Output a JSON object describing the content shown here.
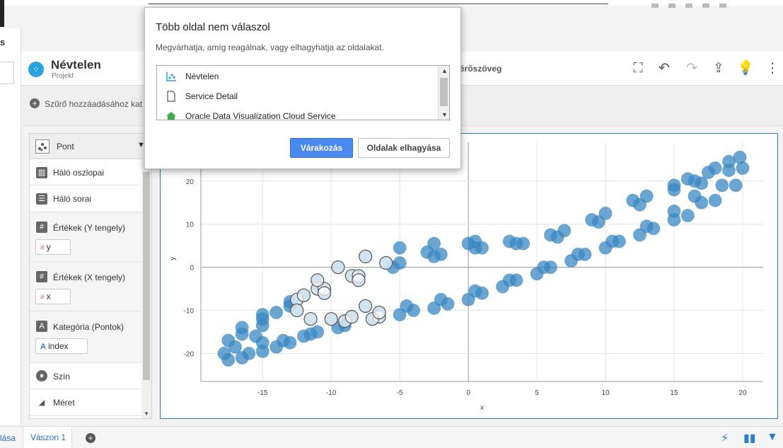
{
  "browser": {
    "cut_left_text": "s"
  },
  "project": {
    "name": "Névtelen",
    "subtitle": "Projekt",
    "title_fragment": "érőszöveg"
  },
  "toolbar_icons": [
    "present-icon",
    "undo-icon",
    "redo-icon",
    "share-icon",
    "insight-icon",
    "more-icon"
  ],
  "filterbar": {
    "placeholder_text": "Szűrő hozzáadásához kat"
  },
  "grammar": {
    "viz_type": "Pont",
    "sections": [
      {
        "label": "Háló oszlopai",
        "icon": "grid-columns-icon"
      },
      {
        "label": "Háló sorai",
        "icon": "grid-rows-icon"
      },
      {
        "label": "Értékek (Y tengely)",
        "icon": "hash-icon",
        "pill": "y",
        "pill_type": "number"
      },
      {
        "label": "Értékek (X tengely)",
        "icon": "hash-icon",
        "pill": "x",
        "pill_type": "number"
      },
      {
        "label": "Kategória (Pontok)",
        "icon": "text-icon",
        "pill": "index",
        "pill_type": "attribute"
      },
      {
        "label": "Szín",
        "icon": "palette-icon"
      },
      {
        "label": "Méret",
        "icon": "size-icon"
      }
    ]
  },
  "chart_data": {
    "type": "scatter",
    "title": "",
    "xlabel": "x",
    "ylabel": "y",
    "xlim": [
      -19.5,
      21.5
    ],
    "ylim": [
      -26.5,
      29
    ],
    "xticks": [
      -15,
      -10,
      -5,
      0,
      5,
      10,
      15,
      20
    ],
    "yticks": [
      -20,
      -10,
      0,
      10,
      20
    ],
    "grid": true,
    "marker_color": "#3a87c1",
    "highlight_color": "#555555",
    "highlight_region": {
      "x": [
        -12.5,
        -6
      ],
      "y": [
        -13,
        5
      ]
    },
    "series": [
      {
        "values_xy": [
          [
            -7.5,
            -9.0
          ],
          [
            -9.0,
            -12.5
          ],
          [
            -11.0,
            -15.0
          ],
          [
            -13.0,
            -17.5
          ],
          [
            -15.0,
            -19.5
          ],
          [
            -16.5,
            -21.0
          ],
          [
            -17.5,
            -21.5
          ],
          [
            -17.8,
            -20.0
          ],
          [
            -17.5,
            -17.0
          ],
          [
            -16.5,
            -14.0
          ],
          [
            -15.0,
            -11.0
          ],
          [
            -13.0,
            -8.0
          ],
          [
            -11.0,
            -5.0
          ],
          [
            -8.5,
            -2.0
          ],
          [
            -6.0,
            1.0
          ],
          [
            -3.0,
            3.5
          ],
          [
            0.0,
            5.5
          ],
          [
            3.0,
            6.0
          ],
          [
            6.0,
            7.5
          ],
          [
            9.0,
            11.0
          ],
          [
            12.0,
            15.5
          ],
          [
            15.0,
            19.0
          ],
          [
            17.5,
            22.0
          ],
          [
            19.0,
            24.5
          ],
          [
            19.8,
            25.5
          ],
          [
            20.0,
            23.0
          ],
          [
            19.5,
            19.0
          ],
          [
            18.0,
            15.5
          ],
          [
            16.0,
            12.0
          ],
          [
            13.5,
            9.0
          ],
          [
            11.0,
            6.0
          ],
          [
            8.5,
            3.0
          ],
          [
            6.0,
            0.0
          ],
          [
            3.5,
            -3.0
          ],
          [
            1.0,
            -6.0
          ],
          [
            -1.5,
            -8.5
          ],
          [
            -4.0,
            -10.0
          ],
          [
            -6.5,
            -11.5
          ],
          [
            -9.0,
            -13.5
          ],
          [
            -11.5,
            -15.5
          ],
          [
            -13.5,
            -17.0
          ],
          [
            -15.0,
            -17.5
          ],
          [
            -15.5,
            -16.0
          ],
          [
            -15.0,
            -13.5
          ],
          [
            -14.0,
            -10.5
          ],
          [
            -12.5,
            -7.5
          ],
          [
            -10.5,
            -5.0
          ],
          [
            -8.0,
            -2.0
          ],
          [
            -5.0,
            1.0
          ],
          [
            -2.0,
            3.0
          ],
          [
            1.0,
            4.5
          ],
          [
            4.0,
            5.5
          ],
          [
            7.0,
            8.5
          ],
          [
            10.0,
            12.5
          ],
          [
            13.0,
            16.5
          ],
          [
            16.0,
            20.5
          ],
          [
            18.0,
            23.0
          ],
          [
            19.0,
            22.5
          ],
          [
            18.5,
            19.0
          ],
          [
            17.0,
            15.0
          ],
          [
            15.0,
            11.0
          ],
          [
            12.5,
            7.5
          ],
          [
            10.0,
            4.5
          ],
          [
            7.5,
            1.5
          ],
          [
            5.0,
            -1.5
          ],
          [
            2.5,
            -4.5
          ],
          [
            0.0,
            -7.5
          ],
          [
            -2.5,
            -9.5
          ],
          [
            -5.0,
            -11.0
          ],
          [
            -7.0,
            -12.0
          ],
          [
            -9.5,
            -14.0
          ],
          [
            -12.0,
            -16.0
          ],
          [
            -14.0,
            -18.5
          ],
          [
            -16.0,
            -20.0
          ],
          [
            -17.0,
            -18.5
          ],
          [
            -16.5,
            -15.5
          ],
          [
            -15.0,
            -12.0
          ],
          [
            -13.0,
            -9.0
          ],
          [
            -10.5,
            -6.0
          ],
          [
            -8.0,
            -3.0
          ],
          [
            -5.5,
            0.0
          ],
          [
            -2.5,
            2.5
          ],
          [
            0.5,
            4.5
          ],
          [
            3.5,
            5.5
          ],
          [
            6.5,
            7.0
          ],
          [
            9.5,
            10.5
          ],
          [
            12.5,
            14.5
          ],
          [
            15.0,
            18.0
          ],
          [
            16.5,
            20.0
          ],
          [
            17.0,
            19.5
          ],
          [
            16.5,
            16.5
          ],
          [
            15.0,
            13.0
          ],
          [
            13.0,
            9.5
          ],
          [
            10.5,
            6.0
          ],
          [
            8.0,
            3.0
          ],
          [
            5.5,
            0.0
          ],
          [
            3.0,
            -3.0
          ],
          [
            0.5,
            -5.5
          ],
          [
            -2.0,
            -7.5
          ],
          [
            -4.5,
            -9.0
          ],
          [
            -6.5,
            -10.5
          ],
          [
            -8.5,
            -11.5
          ],
          [
            -10.0,
            -12.0
          ],
          [
            -11.5,
            -12.0
          ],
          [
            -12.5,
            -10.0
          ],
          [
            -12.0,
            -6.5
          ],
          [
            -11.0,
            -3.0
          ],
          [
            -9.5,
            0.0
          ],
          [
            -7.5,
            2.5
          ],
          [
            -5.0,
            4.5
          ],
          [
            -2.5,
            5.5
          ],
          [
            0.5,
            6.0
          ]
        ]
      }
    ]
  },
  "dialog": {
    "title": "Több oldal nem válaszol",
    "message": "Megvárhatja, amíg reagálnak, vagy elhagyhatja az oldalakat.",
    "items": [
      {
        "label": "Névtelen",
        "icon": "dv-chart-icon"
      },
      {
        "label": "Service Detail",
        "icon": "document-icon"
      },
      {
        "label": "Oracle Data Visualization Cloud Service",
        "icon": "home-icon"
      }
    ],
    "wait_button": "Várakozás",
    "leave_button": "Oldalak elhagyása"
  },
  "bottombar": {
    "frag_text": "lása",
    "tab_label": "Vászon 1",
    "icons": [
      "lightning-icon",
      "chart-settings-icon",
      "filter-icon"
    ]
  }
}
